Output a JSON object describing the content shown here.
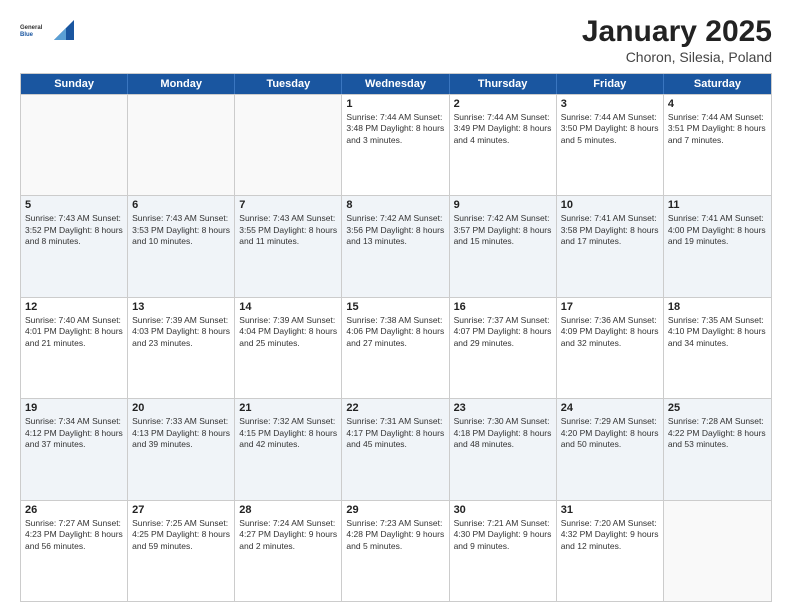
{
  "logo": {
    "general": "General",
    "blue": "Blue"
  },
  "header": {
    "title": "January 2025",
    "subtitle": "Choron, Silesia, Poland"
  },
  "weekdays": [
    "Sunday",
    "Monday",
    "Tuesday",
    "Wednesday",
    "Thursday",
    "Friday",
    "Saturday"
  ],
  "rows": [
    [
      {
        "day": "",
        "text": ""
      },
      {
        "day": "",
        "text": ""
      },
      {
        "day": "",
        "text": ""
      },
      {
        "day": "1",
        "text": "Sunrise: 7:44 AM\nSunset: 3:48 PM\nDaylight: 8 hours and 3 minutes."
      },
      {
        "day": "2",
        "text": "Sunrise: 7:44 AM\nSunset: 3:49 PM\nDaylight: 8 hours and 4 minutes."
      },
      {
        "day": "3",
        "text": "Sunrise: 7:44 AM\nSunset: 3:50 PM\nDaylight: 8 hours and 5 minutes."
      },
      {
        "day": "4",
        "text": "Sunrise: 7:44 AM\nSunset: 3:51 PM\nDaylight: 8 hours and 7 minutes."
      }
    ],
    [
      {
        "day": "5",
        "text": "Sunrise: 7:43 AM\nSunset: 3:52 PM\nDaylight: 8 hours and 8 minutes."
      },
      {
        "day": "6",
        "text": "Sunrise: 7:43 AM\nSunset: 3:53 PM\nDaylight: 8 hours and 10 minutes."
      },
      {
        "day": "7",
        "text": "Sunrise: 7:43 AM\nSunset: 3:55 PM\nDaylight: 8 hours and 11 minutes."
      },
      {
        "day": "8",
        "text": "Sunrise: 7:42 AM\nSunset: 3:56 PM\nDaylight: 8 hours and 13 minutes."
      },
      {
        "day": "9",
        "text": "Sunrise: 7:42 AM\nSunset: 3:57 PM\nDaylight: 8 hours and 15 minutes."
      },
      {
        "day": "10",
        "text": "Sunrise: 7:41 AM\nSunset: 3:58 PM\nDaylight: 8 hours and 17 minutes."
      },
      {
        "day": "11",
        "text": "Sunrise: 7:41 AM\nSunset: 4:00 PM\nDaylight: 8 hours and 19 minutes."
      }
    ],
    [
      {
        "day": "12",
        "text": "Sunrise: 7:40 AM\nSunset: 4:01 PM\nDaylight: 8 hours and 21 minutes."
      },
      {
        "day": "13",
        "text": "Sunrise: 7:39 AM\nSunset: 4:03 PM\nDaylight: 8 hours and 23 minutes."
      },
      {
        "day": "14",
        "text": "Sunrise: 7:39 AM\nSunset: 4:04 PM\nDaylight: 8 hours and 25 minutes."
      },
      {
        "day": "15",
        "text": "Sunrise: 7:38 AM\nSunset: 4:06 PM\nDaylight: 8 hours and 27 minutes."
      },
      {
        "day": "16",
        "text": "Sunrise: 7:37 AM\nSunset: 4:07 PM\nDaylight: 8 hours and 29 minutes."
      },
      {
        "day": "17",
        "text": "Sunrise: 7:36 AM\nSunset: 4:09 PM\nDaylight: 8 hours and 32 minutes."
      },
      {
        "day": "18",
        "text": "Sunrise: 7:35 AM\nSunset: 4:10 PM\nDaylight: 8 hours and 34 minutes."
      }
    ],
    [
      {
        "day": "19",
        "text": "Sunrise: 7:34 AM\nSunset: 4:12 PM\nDaylight: 8 hours and 37 minutes."
      },
      {
        "day": "20",
        "text": "Sunrise: 7:33 AM\nSunset: 4:13 PM\nDaylight: 8 hours and 39 minutes."
      },
      {
        "day": "21",
        "text": "Sunrise: 7:32 AM\nSunset: 4:15 PM\nDaylight: 8 hours and 42 minutes."
      },
      {
        "day": "22",
        "text": "Sunrise: 7:31 AM\nSunset: 4:17 PM\nDaylight: 8 hours and 45 minutes."
      },
      {
        "day": "23",
        "text": "Sunrise: 7:30 AM\nSunset: 4:18 PM\nDaylight: 8 hours and 48 minutes."
      },
      {
        "day": "24",
        "text": "Sunrise: 7:29 AM\nSunset: 4:20 PM\nDaylight: 8 hours and 50 minutes."
      },
      {
        "day": "25",
        "text": "Sunrise: 7:28 AM\nSunset: 4:22 PM\nDaylight: 8 hours and 53 minutes."
      }
    ],
    [
      {
        "day": "26",
        "text": "Sunrise: 7:27 AM\nSunset: 4:23 PM\nDaylight: 8 hours and 56 minutes."
      },
      {
        "day": "27",
        "text": "Sunrise: 7:25 AM\nSunset: 4:25 PM\nDaylight: 8 hours and 59 minutes."
      },
      {
        "day": "28",
        "text": "Sunrise: 7:24 AM\nSunset: 4:27 PM\nDaylight: 9 hours and 2 minutes."
      },
      {
        "day": "29",
        "text": "Sunrise: 7:23 AM\nSunset: 4:28 PM\nDaylight: 9 hours and 5 minutes."
      },
      {
        "day": "30",
        "text": "Sunrise: 7:21 AM\nSunset: 4:30 PM\nDaylight: 9 hours and 9 minutes."
      },
      {
        "day": "31",
        "text": "Sunrise: 7:20 AM\nSunset: 4:32 PM\nDaylight: 9 hours and 12 minutes."
      },
      {
        "day": "",
        "text": ""
      }
    ]
  ]
}
